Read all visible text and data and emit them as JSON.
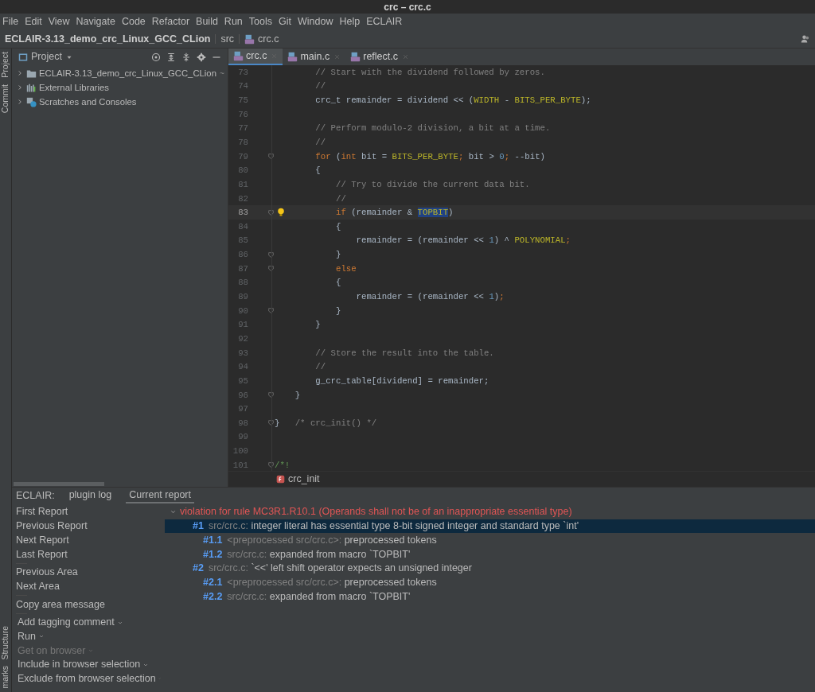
{
  "window": {
    "title": "crc – crc.c"
  },
  "menu": [
    "File",
    "Edit",
    "View",
    "Navigate",
    "Code",
    "Refactor",
    "Build",
    "Run",
    "Tools",
    "Git",
    "Window",
    "Help",
    "ECLAIR"
  ],
  "breadcrumb": [
    "ECLAIR-3.13_demo_crc_Linux_GCC_CLion",
    "src",
    "crc.c"
  ],
  "side_strip": {
    "top": [
      "Project",
      "Commit"
    ],
    "bottom": [
      "Structure",
      "marks"
    ]
  },
  "project_panel": {
    "title": "Project",
    "items": [
      {
        "label": "ECLAIR-3.13_demo_crc_Linux_GCC_CLion",
        "hint": "~",
        "kind": "folder",
        "expanded": false
      },
      {
        "label": "External Libraries",
        "kind": "library",
        "expanded": false
      },
      {
        "label": "Scratches and Consoles",
        "kind": "scratch",
        "expanded": false
      }
    ]
  },
  "editor_tabs": [
    {
      "label": "crc.c",
      "selected": true
    },
    {
      "label": "main.c",
      "selected": false
    },
    {
      "label": "reflect.c",
      "selected": false
    }
  ],
  "code_lines": [
    {
      "number": "73",
      "tokens": [
        {
          "kind": "comment",
          "text": "        // Start with the dividend followed by zeros."
        }
      ]
    },
    {
      "number": "74",
      "tokens": [
        {
          "kind": "comment",
          "text": "        //"
        }
      ]
    },
    {
      "number": "75",
      "tokens": [
        {
          "kind": "plain",
          "text": "        crc_t remainder = dividend << ("
        },
        {
          "kind": "macro",
          "text": "WIDTH"
        },
        {
          "kind": "plain",
          "text": " - "
        },
        {
          "kind": "macro",
          "text": "BITS_PER_BYTE"
        },
        {
          "kind": "plain",
          "text": ");"
        }
      ]
    },
    {
      "number": "76"
    },
    {
      "number": "77",
      "tokens": [
        {
          "kind": "comment",
          "text": "        // Perform modulo-2 division, a bit at a time."
        }
      ]
    },
    {
      "number": "78",
      "tokens": [
        {
          "kind": "comment",
          "text": "        //"
        }
      ]
    },
    {
      "number": "79",
      "fold": true,
      "tokens": [
        {
          "kind": "keyword",
          "text": "        for"
        },
        {
          "kind": "plain",
          "text": " ("
        },
        {
          "kind": "keyword",
          "text": "int"
        },
        {
          "kind": "plain",
          "text": " bit = "
        },
        {
          "kind": "macro",
          "text": "BITS_PER_BYTE"
        },
        {
          "kind": "keyword",
          "text": ";"
        },
        {
          "kind": "plain",
          "text": " bit > "
        },
        {
          "kind": "number",
          "text": "0"
        },
        {
          "kind": "keyword",
          "text": ";"
        },
        {
          "kind": "plain",
          "text": " --bit)"
        }
      ]
    },
    {
      "number": "80",
      "tokens": [
        {
          "kind": "plain",
          "text": "        {"
        }
      ]
    },
    {
      "number": "81",
      "tokens": [
        {
          "kind": "comment",
          "text": "            // Try to divide the current data bit."
        }
      ]
    },
    {
      "number": "82",
      "tokens": [
        {
          "kind": "comment",
          "text": "            //"
        }
      ]
    },
    {
      "number": "83",
      "fold": true,
      "bulb": true,
      "current": true,
      "tokens": [
        {
          "kind": "keyword",
          "text": "            if"
        },
        {
          "kind": "plain",
          "text": " (remainder & "
        },
        {
          "kind": "macro_selected",
          "text": "TOPBIT"
        },
        {
          "kind": "plain",
          "text": ")"
        }
      ]
    },
    {
      "number": "84",
      "tokens": [
        {
          "kind": "plain",
          "text": "            {"
        }
      ]
    },
    {
      "number": "85",
      "tokens": [
        {
          "kind": "plain",
          "text": "                remainder = (remainder << "
        },
        {
          "kind": "number",
          "text": "1"
        },
        {
          "kind": "plain",
          "text": ") ^ "
        },
        {
          "kind": "macro",
          "text": "POLYNOMIAL"
        },
        {
          "kind": "keyword",
          "text": ";"
        }
      ]
    },
    {
      "number": "86",
      "fold": true,
      "tokens": [
        {
          "kind": "plain",
          "text": "            }"
        }
      ]
    },
    {
      "number": "87",
      "fold": true,
      "tokens": [
        {
          "kind": "keyword",
          "text": "            else"
        }
      ]
    },
    {
      "number": "88",
      "tokens": [
        {
          "kind": "plain",
          "text": "            {"
        }
      ]
    },
    {
      "number": "89",
      "tokens": [
        {
          "kind": "plain",
          "text": "                remainder = (remainder << "
        },
        {
          "kind": "number",
          "text": "1"
        },
        {
          "kind": "plain",
          "text": ")"
        },
        {
          "kind": "keyword",
          "text": ";"
        }
      ]
    },
    {
      "number": "90",
      "fold": true,
      "tokens": [
        {
          "kind": "plain",
          "text": "            }"
        }
      ]
    },
    {
      "number": "91",
      "tokens": [
        {
          "kind": "plain",
          "text": "        }"
        }
      ]
    },
    {
      "number": "92"
    },
    {
      "number": "93",
      "tokens": [
        {
          "kind": "comment",
          "text": "        // Store the result into the table."
        }
      ]
    },
    {
      "number": "94",
      "tokens": [
        {
          "kind": "comment",
          "text": "        //"
        }
      ]
    },
    {
      "number": "95",
      "tokens": [
        {
          "kind": "plain",
          "text": "        g_crc_table[dividend] = remainder;"
        }
      ]
    },
    {
      "number": "96",
      "fold": true,
      "tokens": [
        {
          "kind": "plain",
          "text": "    }"
        }
      ]
    },
    {
      "number": "97"
    },
    {
      "number": "98",
      "fold": true,
      "tokens": [
        {
          "kind": "plain",
          "text": "}   "
        },
        {
          "kind": "comment",
          "text": "/* crc_init() */"
        }
      ]
    },
    {
      "number": "99"
    },
    {
      "number": "100"
    },
    {
      "number": "101",
      "fold": true,
      "tokens": [
        {
          "kind": "doc",
          "text": "/*!"
        }
      ]
    }
  ],
  "editor_footer": {
    "function": "crc_init"
  },
  "bottom_panel": {
    "label": "ECLAIR:",
    "tabs": [
      {
        "label": "plugin log",
        "selected": false
      },
      {
        "label": "Current report",
        "selected": true
      }
    ],
    "action_groups": [
      {
        "items": [
          {
            "label": "First Report",
            "kind": "action",
            "disabled": false
          },
          {
            "label": "Previous Report",
            "kind": "action",
            "disabled": false
          },
          {
            "label": "Next Report",
            "kind": "action",
            "disabled": false
          },
          {
            "label": "Last Report",
            "kind": "action",
            "disabled": false
          }
        ]
      },
      {
        "items": [
          {
            "label": "Previous Area",
            "kind": "action",
            "disabled": false
          },
          {
            "label": "Next Area",
            "kind": "action",
            "disabled": false
          }
        ]
      },
      {
        "items": [
          {
            "label": "Copy area message",
            "kind": "action",
            "disabled": false
          }
        ]
      },
      {
        "items": [
          {
            "label": "Add tagging comment",
            "kind": "dropdown",
            "disabled": false
          },
          {
            "label": "Run",
            "kind": "dropdown",
            "disabled": false
          },
          {
            "label": "Get on browser",
            "kind": "dropdown",
            "disabled": true
          },
          {
            "label": "Include in browser selection",
            "kind": "dropdown",
            "disabled": false
          },
          {
            "label": "Exclude from browser selection",
            "kind": "dropdown",
            "disabled": false
          }
        ]
      }
    ],
    "report": {
      "title": "violation for rule MC3R1.R10.1 (Operands shall not be of an inappropriate essential type)",
      "expanded": true,
      "children": [
        {
          "id": "#1",
          "location": "src/crc.c:",
          "message": "integer literal has essential type 8-bit signed integer and standard type `int'",
          "selected": true,
          "children": [
            {
              "id": "#1.1",
              "location": "<preprocessed src/crc.c>:",
              "message": "preprocessed tokens",
              "selected": false
            },
            {
              "id": "#1.2",
              "location": "src/crc.c:",
              "message": "expanded from macro `TOPBIT'",
              "selected": false
            }
          ]
        },
        {
          "id": "#2",
          "location": "src/crc.c:",
          "message": "`<<' left shift operator expects an unsigned integer",
          "selected": false,
          "children": [
            {
              "id": "#2.1",
              "location": "<preprocessed src/crc.c>:",
              "message": "preprocessed tokens",
              "selected": false
            },
            {
              "id": "#2.2",
              "location": "src/crc.c:",
              "message": "expanded from macro `TOPBIT'",
              "selected": false
            }
          ]
        }
      ]
    }
  }
}
